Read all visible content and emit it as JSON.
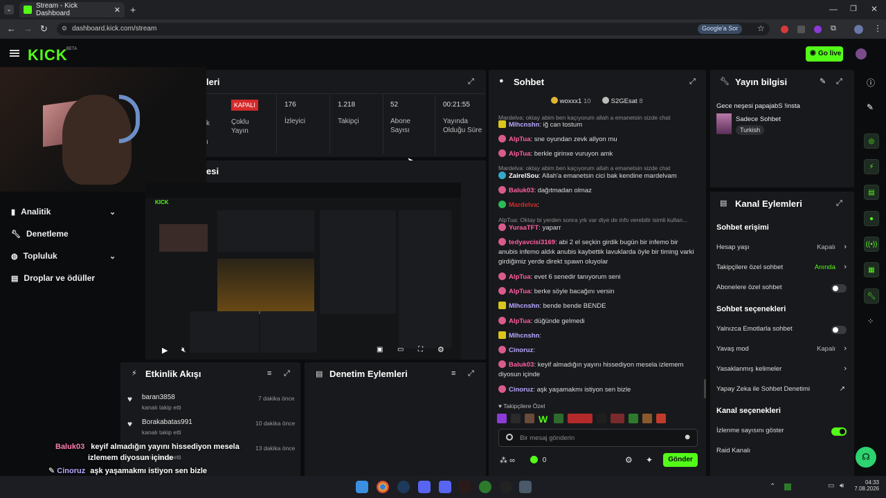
{
  "browser": {
    "tab_title": "Stream - Kick Dashboard",
    "url": "dashboard.kick.com/stream",
    "google_btn": "Google'a Sor"
  },
  "header": {
    "logo": "KICK",
    "beta": "BETA",
    "go_live": "Go live"
  },
  "sidebar": {
    "items": [
      {
        "label": "Analitik",
        "icon": "chart-icon",
        "chevron": true
      },
      {
        "label": "Denetleme",
        "icon": "wrench-icon",
        "chevron": false
      },
      {
        "label": "Topluluk",
        "icon": "users-icon",
        "chevron": true
      },
      {
        "label": "Droplar ve ödüller",
        "icon": "drops-icon",
        "chevron": false
      }
    ]
  },
  "stats_panel": {
    "title_partial": "leri",
    "status_badge": "KAPALI",
    "status_label": "Çoklu Yayın",
    "partial_left": "k",
    "partial_left2": "ı",
    "stats": [
      {
        "value": "176",
        "label": "İzleyici"
      },
      {
        "value": "1.218",
        "label": "Takipçi"
      },
      {
        "value": "52",
        "label": "Abone Sayısı"
      },
      {
        "value": "00:21:55",
        "label": "Yayında Olduğu Süre"
      }
    ]
  },
  "preview_panel": {
    "title_partial": "esi"
  },
  "events_panel": {
    "title": "Etkinlik Akışı",
    "items": [
      {
        "name": "baran3858",
        "sub": "kanalı takip etti",
        "time": "7 dakika önce"
      },
      {
        "name": "Borakabatas991",
        "sub": "kanalı takip etti",
        "time": "10 dakika önce"
      },
      {
        "name": "",
        "sub": "kanalı takip etti",
        "time": "13 dakika önce"
      }
    ]
  },
  "moderation_panel": {
    "title": "Denetim Eylemleri"
  },
  "overlay_chat": [
    {
      "user": "Baluk03",
      "text": "keyif almadığın yayını hissediyon mesela",
      "text2": "izlemem diyosun içinde"
    },
    {
      "user": "Cinoruz",
      "text": "aşk yaşamakmı istiyon sen bizle",
      "text2": ""
    }
  ],
  "chat": {
    "title": "Sohbet",
    "top_users": [
      {
        "name": "woxxx1",
        "count": "10"
      },
      {
        "name": "S2GEsat",
        "count": "8"
      }
    ],
    "messages": [
      {
        "type": "sys",
        "text": "Mardelva: oktay abim ben kaçıyorum allah a emanetsin sizde chat"
      },
      {
        "badge": "y",
        "user": "Mlhcnshn",
        "color": "#b8a8ff",
        "text": ": iğ can tostum"
      },
      {
        "badge": "p",
        "user": "AlpTua",
        "color": "#ff5fa2",
        "text": ": sne oyundan zevk allyon mu"
      },
      {
        "badge": "p",
        "user": "AlpTua",
        "color": "#ff5fa2",
        "text": ": berkle girinxe vuruyon amk"
      },
      {
        "type": "sys",
        "text": "Mardelva: oktay abim ben kaçıyorum allah a emanetsin sizde chat"
      },
      {
        "badge": "t",
        "user": "ZairelSou",
        "color": "#ffffff",
        "text": ": Allah'a emanetsin cici bak kendine mardelvam"
      },
      {
        "badge": "p",
        "user": "Baluk03",
        "color": "#ff5fa2",
        "text": ": dağıtmadan olmaz"
      },
      {
        "badge": "g",
        "user": "Mardelva",
        "color": "#d12d2d",
        "text": ":"
      },
      {
        "type": "sys",
        "text": "AlpTua: Oktay bi yerden sonra yrk var diye de info verebilir isimli kullan..."
      },
      {
        "badge": "p",
        "user": "YuraaTFT",
        "color": "#ff5fa2",
        "text": ": yaparr"
      },
      {
        "badge": "p",
        "user": "tedyavcisi3169",
        "color": "#ff5fa2",
        "text": ": abi 2 el seçkin girdik bugün bir infemo bir anubis infemo aldık anubis kaybettik lavuklarda öyle bir timing varki girdiğimiz yerde direkt spawn oluyolar"
      },
      {
        "badge": "p",
        "user": "AlpTua",
        "color": "#ff5fa2",
        "text": ": evet 6 senedir tanıyorum seni"
      },
      {
        "badge": "p",
        "user": "AlpTua",
        "color": "#ff5fa2",
        "text": ": berke söyle bacağını versin"
      },
      {
        "badge": "y",
        "user": "Mlhcnshn",
        "color": "#b8a8ff",
        "text": ": bende bende BENDE"
      },
      {
        "badge": "p",
        "user": "AlpTua",
        "color": "#ff5fa2",
        "text": ": düğünde gelmedi"
      },
      {
        "badge": "y",
        "user": "Mlhcnshn",
        "color": "#b8a8ff",
        "text": ":"
      },
      {
        "badge": "p",
        "user": "Cinoruz",
        "color": "#b8a8ff",
        "text": ":"
      },
      {
        "badge": "p",
        "user": "Baluk03",
        "color": "#ff5fa2",
        "text": ": keyif almadığın yayını hissediyon mesela izlemem diyosun içinde"
      },
      {
        "badge": "p",
        "user": "Cinoruz",
        "color": "#b8a8ff",
        "text": ": aşk yaşamakmı istiyon sen bizle"
      }
    ],
    "followers_only": "Takipçilere Özel",
    "input_placeholder": "Bir mesaj gönderin",
    "viewers_icon_value": "∞",
    "points": "0",
    "send": "Gönder"
  },
  "stream_info": {
    "title": "Yayın bilgisi",
    "stream_title": "Gece neşesi papajabS !insta",
    "category": "Sadece Sohbet",
    "tag": "Turkish"
  },
  "channel_actions": {
    "title": "Kanal Eylemleri",
    "sections": [
      {
        "heading": "Sohbet erişimi",
        "rows": [
          {
            "label": "Hesap yaşı",
            "value": "Kapalı",
            "kind": "arrow"
          },
          {
            "label": "Takipçilere özel sohbet",
            "value": "Anında",
            "kind": "arrow-green"
          },
          {
            "label": "Abonelere özel sohbet",
            "value": "",
            "kind": "toggle-off"
          }
        ]
      },
      {
        "heading": "Sohbet seçenekleri",
        "rows": [
          {
            "label": "Yalnızca Emotlarla sohbet",
            "value": "",
            "kind": "toggle-off"
          },
          {
            "label": "Yavaş mod",
            "value": "Kapalı",
            "kind": "arrow"
          },
          {
            "label": "Yasaklanmış kelimeler",
            "value": "",
            "kind": "arrow"
          },
          {
            "label": "Yapay Zeka ile Sohbet Denetimi",
            "value": "",
            "kind": "external"
          }
        ]
      },
      {
        "heading": "Kanal seçenekleri",
        "rows": [
          {
            "label": "İzlenme sayısını göster",
            "value": "",
            "kind": "toggle-on"
          },
          {
            "label": "Raid Kanalı",
            "value": "",
            "kind": "none"
          }
        ]
      }
    ]
  },
  "taskbar": {
    "time": "04:33",
    "date": "7.08.2026"
  },
  "colors": {
    "accent": "#53fc18",
    "panel": "#18191c",
    "bg": "#0b0c0e",
    "danger": "#d42a2a"
  }
}
